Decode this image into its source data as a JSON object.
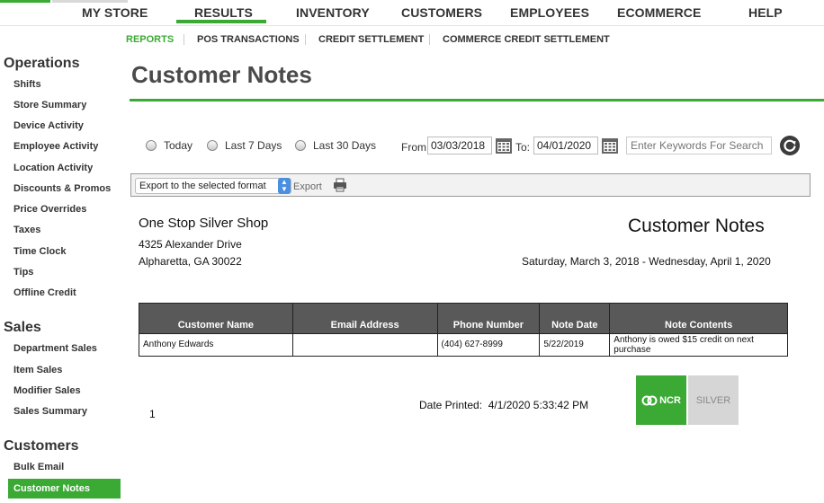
{
  "topnav": {
    "items": [
      "MY STORE",
      "RESULTS",
      "INVENTORY",
      "CUSTOMERS",
      "EMPLOYEES",
      "ECOMMERCE",
      "HELP"
    ],
    "active": "RESULTS"
  },
  "subnav": {
    "items": [
      "REPORTS",
      "POS TRANSACTIONS",
      "CREDIT SETTLEMENT",
      "COMMERCE CREDIT SETTLEMENT"
    ],
    "active": "REPORTS"
  },
  "sidebar": {
    "operations": {
      "title": "Operations",
      "items": [
        "Shifts",
        "Store Summary",
        "Device Activity",
        "Employee Activity",
        "Location Activity",
        "Discounts & Promos",
        "Price Overrides",
        "Taxes",
        "Time Clock",
        "Tips",
        "Offline Credit"
      ]
    },
    "sales": {
      "title": "Sales",
      "items": [
        "Department Sales",
        "Item Sales",
        "Modifier Sales",
        "Sales Summary"
      ]
    },
    "customers": {
      "title": "Customers",
      "items": [
        "Bulk Email",
        "Customer Notes"
      ],
      "active": "Customer Notes"
    }
  },
  "page": {
    "title": "Customer Notes"
  },
  "filters": {
    "radios": [
      "Today",
      "Last 7 Days",
      "Last 30 Days"
    ],
    "from_label": "From:",
    "from_value": "03/03/2018",
    "to_label": "To:",
    "to_value": "04/01/2020",
    "search_placeholder": "Enter Keywords For Search"
  },
  "toolbar": {
    "format_select": "Export to the selected format",
    "export_label": "Export"
  },
  "report": {
    "store_name": "One Stop Silver Shop",
    "address_line1": "4325 Alexander Drive",
    "address_line2": "Alpharetta, GA 30022",
    "title": "Customer Notes",
    "date_range": "Saturday, March 3, 2018 - Wednesday, April 1, 2020",
    "columns": [
      "Customer Name",
      "Email Address",
      "Phone Number",
      "Note Date",
      "Note Contents"
    ],
    "rows": [
      [
        "Anthony Edwards",
        "",
        "(404) 627-8999",
        "5/22/2019",
        "Anthony is owed $15 credit on next purchase"
      ]
    ],
    "page_number": "1",
    "date_printed_label": "Date Printed:",
    "date_printed_value": "4/1/2020 5:33:42 PM"
  },
  "logos": {
    "ncr": "NCR",
    "silver": "SILVER"
  },
  "colors": {
    "accent": "#3aaa35",
    "table_header": "#595959",
    "title": "#4a4a4a"
  }
}
